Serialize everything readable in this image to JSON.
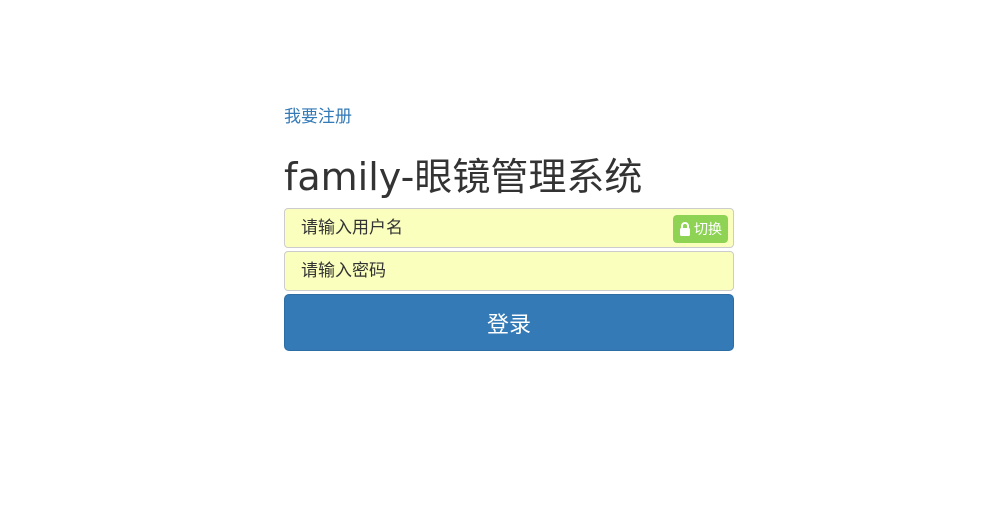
{
  "register_link": "我要注册",
  "title": "family-眼镜管理系统",
  "username": {
    "value": "",
    "placeholder": "请输入用户名",
    "switch_label": "切换",
    "switch_icon": "lock-icon"
  },
  "password": {
    "value": "",
    "placeholder": "请输入密码"
  },
  "login_label": "登录",
  "colors": {
    "link": "#337ab7",
    "input_bg": "#faffbd",
    "switch_bg": "#8ed354",
    "primary": "#337ab7"
  }
}
